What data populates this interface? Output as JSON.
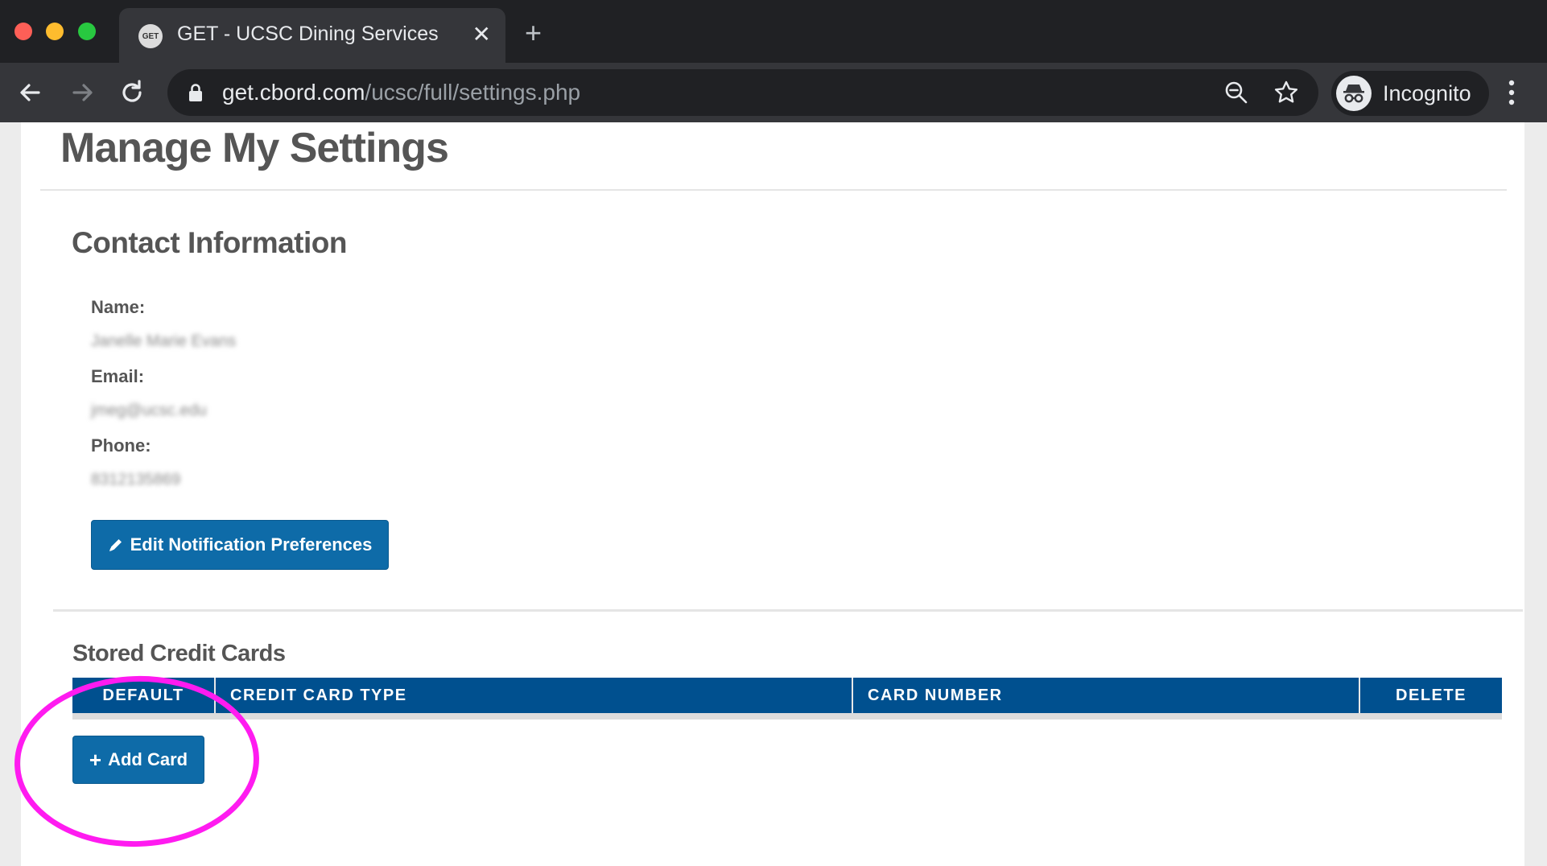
{
  "browser": {
    "tab_title": "GET - UCSC Dining Services",
    "tab_favicon_text": "GET",
    "url_domain": "get.cbord.com",
    "url_path": "/ucsc/full/settings.php",
    "profile_label": "Incognito"
  },
  "page": {
    "title": "Manage My Settings",
    "contact": {
      "heading": "Contact Information",
      "name_label": "Name:",
      "name_value": "Janelle Marie Evans",
      "email_label": "Email:",
      "email_value": "jmeg@ucsc.edu",
      "phone_label": "Phone:",
      "phone_value": "8312135869",
      "edit_button": "Edit Notification Preferences"
    },
    "cards": {
      "heading": "Stored Credit Cards",
      "columns": [
        "DEFAULT",
        "CREDIT CARD TYPE",
        "CARD NUMBER",
        "DELETE"
      ],
      "add_button": "Add Card"
    }
  },
  "colors": {
    "primary_button": "#0e6ba8",
    "table_header": "#00508f",
    "annotation": "#ff1bf0"
  }
}
